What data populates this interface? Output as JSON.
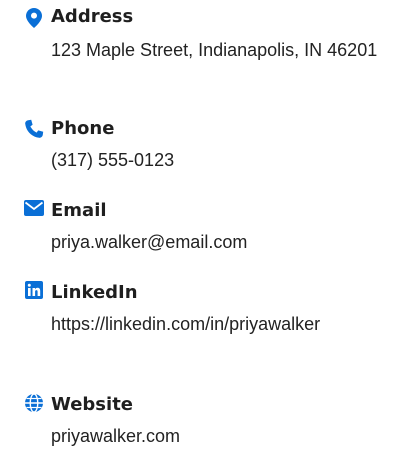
{
  "accent_color": "#0a6fd6",
  "items": [
    {
      "icon": "location-pin-icon",
      "label": "Address",
      "value": "123 Maple Street, Indianapolis, IN 46201"
    },
    {
      "icon": "phone-icon",
      "label": "Phone",
      "value": "(317) 555-0123"
    },
    {
      "icon": "envelope-icon",
      "label": "Email",
      "value": "priya.walker@email.com"
    },
    {
      "icon": "linkedin-icon",
      "label": "LinkedIn",
      "value": "https://linkedin.com/in/priyawalker"
    },
    {
      "icon": "globe-icon",
      "label": "Website",
      "value": "priyawalker.com"
    }
  ]
}
